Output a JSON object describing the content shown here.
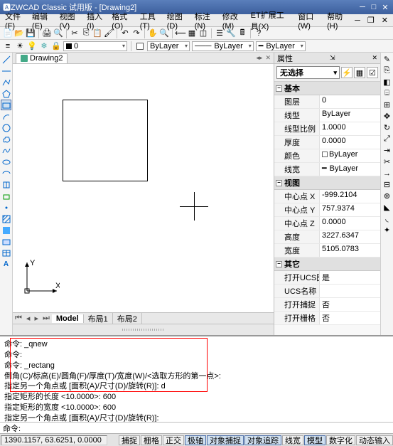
{
  "title": "ZWCAD Classic 试用版 - [Drawing2]",
  "menus": [
    "文件(F)",
    "编辑(E)",
    "视图(V)",
    "插入(I)",
    "格式(O)",
    "工具(T)",
    "绘图(D)",
    "标注(N)",
    "修改(M)",
    "ET扩展工具(X)",
    "窗口(W)",
    "帮助(H)"
  ],
  "doc_tab": "Drawing2",
  "layer": {
    "current": "0",
    "bylayer1": "ByLayer",
    "bylayer2": "ByLayer",
    "bylayer3": "ByLayer"
  },
  "bottom_tabs": {
    "model": "Model",
    "layout1": "布局1",
    "layout2": "布局2"
  },
  "props": {
    "title": "属性",
    "none": "无选择",
    "groups": {
      "basic": "基本",
      "view": "视图",
      "other": "其它"
    },
    "basic": {
      "layer_k": "图层",
      "layer_v": "0",
      "ltype_k": "线型",
      "ltype_v": "ByLayer",
      "ltscale_k": "线型比例",
      "ltscale_v": "1.0000",
      "thick_k": "厚度",
      "thick_v": "0.0000",
      "color_k": "颜色",
      "color_v": "ByLayer",
      "lw_k": "线宽",
      "lw_v": "ByLayer"
    },
    "view": {
      "cx_k": "中心点 X",
      "cx_v": "-999.2104",
      "cy_k": "中心点 Y",
      "cy_v": "757.9374",
      "cz_k": "中心点 Z",
      "cz_v": "0.0000",
      "h_k": "高度",
      "h_v": "3227.6347",
      "w_k": "宽度",
      "w_v": "5105.0783"
    },
    "other": {
      "ucs_k": "打开UCS图标",
      "ucs_v": "是",
      "ucsn_k": "UCS名称",
      "ucsn_v": "",
      "osnap_k": "打开捕捉",
      "osnap_v": "否",
      "grid_k": "打开栅格",
      "grid_v": "否"
    }
  },
  "cmd": {
    "l1": "命令: _qnew",
    "l2": "命令:",
    "l3": "命令: _rectang",
    "l4": "倒角(C)/标高(E)/圆角(F)/厚度(T)/宽度(W)/<选取方形的第一点>:",
    "l5": "指定另一个角点或 [面积(A)/尺寸(D)/旋转(R)]: d",
    "l6": "指定矩形的长度 <10.0000>: 600",
    "l7": "指定矩形的宽度 <10.0000>: 600",
    "l8": "指定另一个角点或 [面积(A)/尺寸(D)/旋转(R)]:",
    "prompt": "命令:"
  },
  "status": {
    "coords": "1390.1157, 63.6251, 0.0000",
    "btns": [
      "捕捉",
      "栅格",
      "正交",
      "极轴",
      "对象捕捉",
      "对象追踪",
      "线宽",
      "模型",
      "数字化",
      "动态输入"
    ]
  }
}
